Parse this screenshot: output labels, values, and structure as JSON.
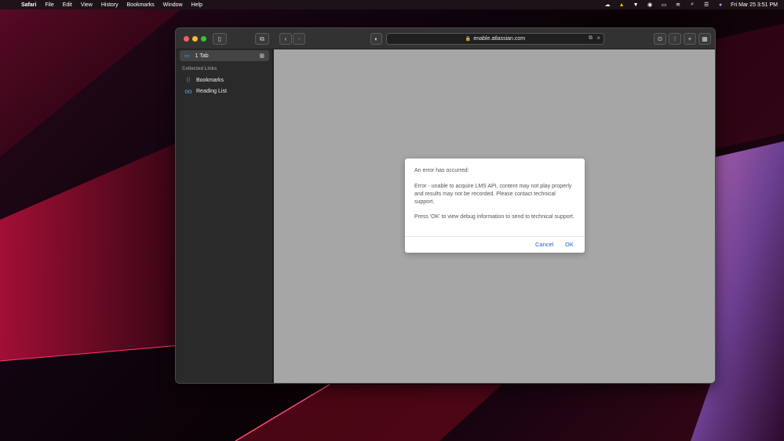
{
  "menubar": {
    "items": [
      "Safari",
      "File",
      "Edit",
      "View",
      "History",
      "Bookmarks",
      "Window",
      "Help"
    ],
    "clock": "Fri Mar 25  3:51 PM"
  },
  "browser": {
    "address": "enable.atlassian.com",
    "sidebar": {
      "tab_label": "1 Tab",
      "section_title": "Collected Links",
      "items": [
        {
          "label": "Bookmarks",
          "icon": "bookmark-icon"
        },
        {
          "label": "Reading List",
          "icon": "glasses-icon"
        }
      ]
    }
  },
  "dialog": {
    "title": "An error has occurred:",
    "message": "Error - unable to acquire LMS API, content may not play properly and results may not be recorded.  Please contact technical support.",
    "debug_message": "Press 'OK' to view debug information to send to technical support.",
    "cancel_label": "Cancel",
    "ok_label": "OK"
  },
  "colors": {
    "accent": "#1f5fd1",
    "content_background": "#a6a6a6"
  }
}
